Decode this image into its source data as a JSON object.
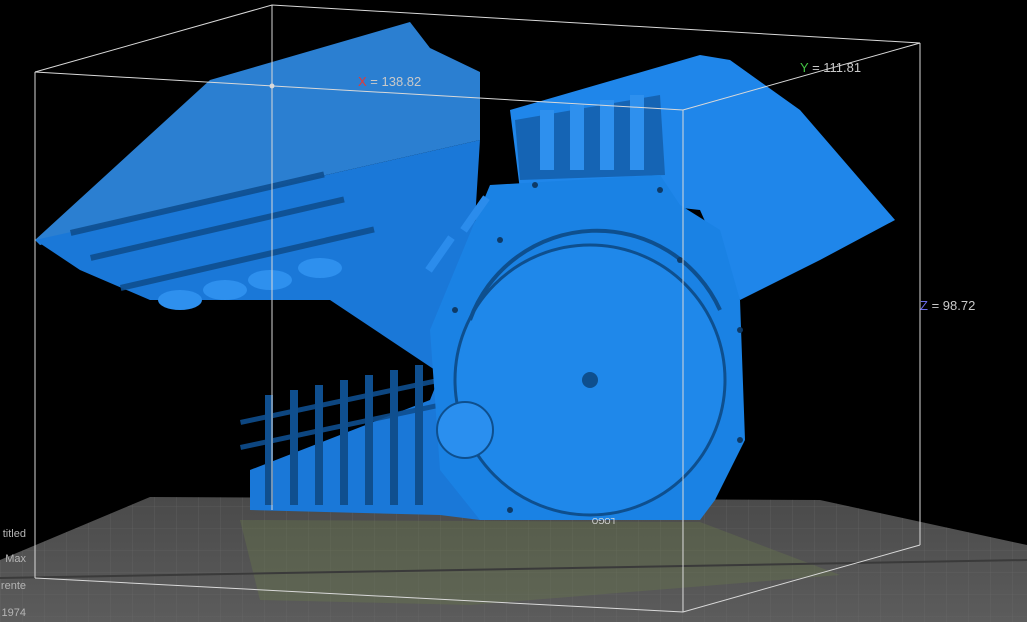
{
  "viewport": {
    "background": "#000000",
    "model_color": "#1f88ea",
    "model_shade": "#155fa6",
    "bed_color": "#5a5a5a",
    "bbox_color": "#d9d9d9"
  },
  "dimensions": {
    "x": {
      "axis": "X",
      "value": "= 138.82",
      "color": "#e53935"
    },
    "y": {
      "axis": "Y",
      "value": "= 111.81",
      "color": "#43c443"
    },
    "z": {
      "axis": "Z",
      "value": "= 98.72",
      "color": "#6a6ae8"
    }
  },
  "model": {
    "name": "engine-block-model",
    "bed_engraving": "LOGO"
  },
  "left_panel": {
    "rows": [
      "titled",
      "Max",
      "rente",
      "1974"
    ]
  }
}
